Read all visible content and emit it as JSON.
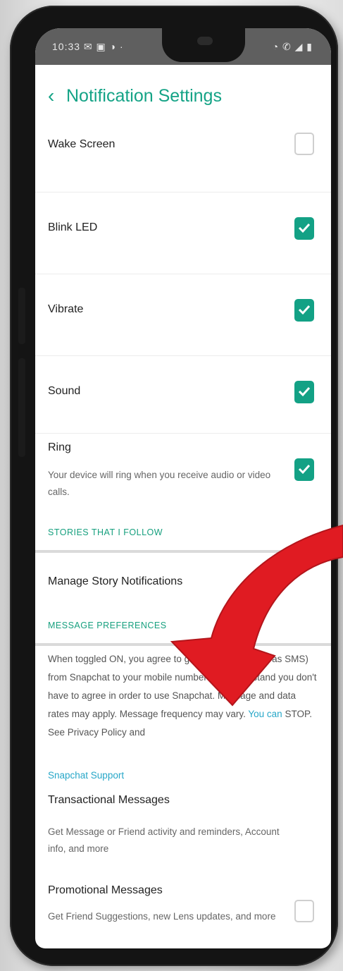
{
  "status_bar": {
    "left": "10:33 ✉ ▣ ◑ ·",
    "right": "◔ ✆ ◢ ▮"
  },
  "header": {
    "title": "Notification Settings"
  },
  "rows": [
    {
      "label": "Wake Screen",
      "checked": false
    },
    {
      "label": "Blink LED",
      "checked": true
    },
    {
      "label": "Vibrate",
      "checked": true
    },
    {
      "label": "Sound",
      "checked": true
    },
    {
      "label": "Ring",
      "description": "Your device will ring when you receive audio or video calls.",
      "checked": true
    }
  ],
  "sections": {
    "stories": "STORIES THAT I FOLLOW",
    "message_prefs": "MESSAGE PREFERENCES"
  },
  "manage_story": "Manage Story Notifications",
  "preferences_text": {
    "part1": "When toggled ON, you agree to get messages (such as SMS) from Snapchat to your mobile number and understand you don't have to agree in order to use Snapchat. Message and data rates may apply. Message frequency may vary. ",
    "link1": "You can",
    "part2": " STOP. See Privacy Policy and",
    "support": "Snapchat Support"
  },
  "transactional": {
    "label": "Transactional Messages",
    "description": "Get Message or Friend activity and reminders, Account info, and more"
  },
  "promotional": {
    "label": "Promotional Messages",
    "description": "Get Friend Suggestions, new Lens updates, and more",
    "checked": false
  },
  "colors": {
    "accent": "#13a185",
    "arrow": "#e01b22"
  }
}
